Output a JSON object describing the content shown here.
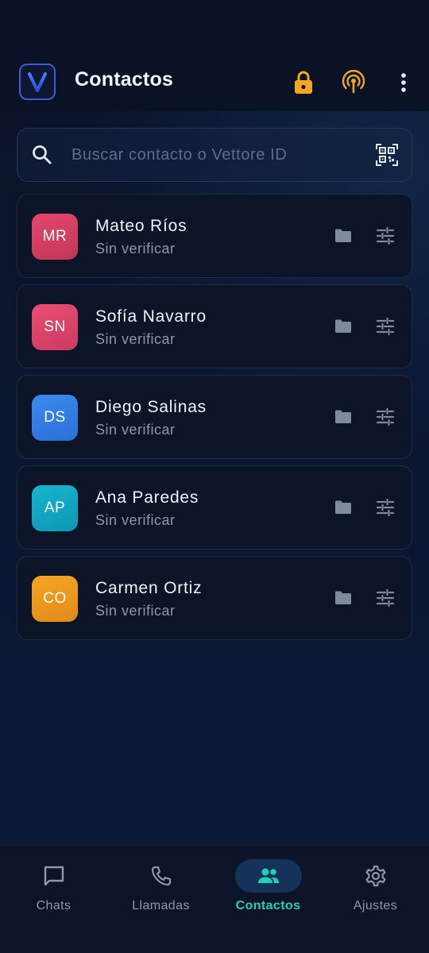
{
  "header": {
    "title": "Contactos",
    "logo_letter": "V",
    "icons": [
      "lock-icon",
      "broadcast-icon",
      "more-vert-icon"
    ]
  },
  "search": {
    "placeholder": "Buscar contacto o Vettore ID",
    "icon": "search-icon",
    "qr_icon": "qr-scan-icon"
  },
  "contacts": [
    {
      "initials": "MR",
      "name": "Mateo Ríos",
      "status": "Sin verificar",
      "color_top": "#e5466c",
      "color_bottom": "#c23759"
    },
    {
      "initials": "SN",
      "name": "Sofía Navarro",
      "status": "Sin verificar",
      "color_top": "#ea4d72",
      "color_bottom": "#cb3b60"
    },
    {
      "initials": "DS",
      "name": "Diego Salinas",
      "status": "Sin verificar",
      "color_top": "#3b8af0",
      "color_bottom": "#2a6fd6"
    },
    {
      "initials": "AP",
      "name": "Ana Paredes",
      "status": "Sin verificar",
      "color_top": "#17b5cf",
      "color_bottom": "#0c97b6"
    },
    {
      "initials": "CO",
      "name": "Carmen Ortiz",
      "status": "Sin verificar",
      "color_top": "#f5a623",
      "color_bottom": "#e18a1a"
    }
  ],
  "nav": {
    "items": [
      {
        "label": "Chats",
        "icon": "chat-icon"
      },
      {
        "label": "Llamadas",
        "icon": "phone-icon"
      },
      {
        "label": "Contactos",
        "icon": "contacts-icon",
        "active": true
      },
      {
        "label": "Ajustes",
        "icon": "settings-icon"
      }
    ]
  },
  "colors": {
    "accent": "#21d1b5",
    "warning": "#f5a623",
    "brand": "#3d5bd9"
  }
}
